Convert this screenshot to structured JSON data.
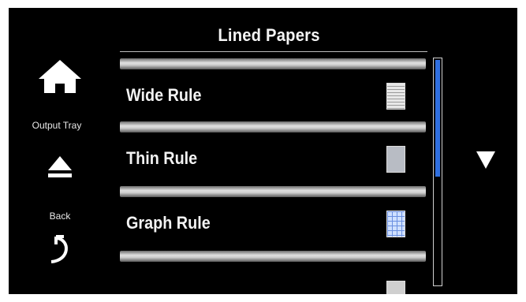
{
  "header": {
    "title": "Lined Papers"
  },
  "sidebar": {
    "home_icon": "home-icon",
    "output_tray_label": "Output Tray",
    "eject_icon": "eject-icon",
    "back_label": "Back",
    "back_icon": "back-arrow-icon"
  },
  "list": {
    "items": [
      {
        "label": "Wide Rule",
        "icon": "wide-rule-paper-icon"
      },
      {
        "label": "Thin Rule",
        "icon": "thin-rule-paper-icon"
      },
      {
        "label": "Graph Rule",
        "icon": "graph-rule-paper-icon"
      }
    ]
  },
  "scroll": {
    "down_icon": "scroll-down-arrow-icon"
  },
  "colors": {
    "accent": "#2f6fe0",
    "background": "#000000",
    "text": "#f2f2f2"
  }
}
